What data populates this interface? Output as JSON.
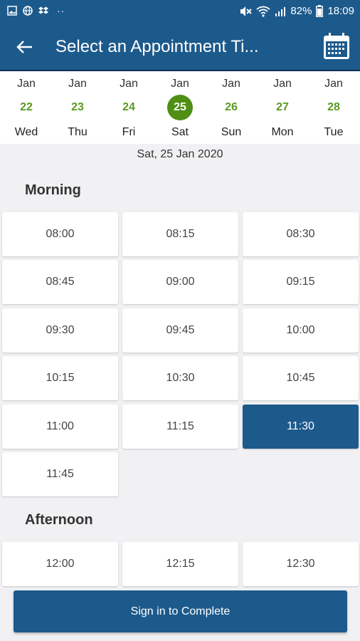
{
  "status_bar": {
    "battery": "82%",
    "time": "18:09",
    "dots": "··"
  },
  "app_bar": {
    "title": "Select an Appointment Ti..."
  },
  "days": [
    {
      "month": "Jan",
      "date": "22",
      "weekday": "Wed"
    },
    {
      "month": "Jan",
      "date": "23",
      "weekday": "Thu"
    },
    {
      "month": "Jan",
      "date": "24",
      "weekday": "Fri"
    },
    {
      "month": "Jan",
      "date": "25",
      "weekday": "Sat"
    },
    {
      "month": "Jan",
      "date": "26",
      "weekday": "Sun"
    },
    {
      "month": "Jan",
      "date": "27",
      "weekday": "Mon"
    },
    {
      "month": "Jan",
      "date": "28",
      "weekday": "Tue"
    }
  ],
  "selected_date_label": "Sat, 25 Jan 2020",
  "morning": {
    "title": "Morning",
    "slots": [
      "08:00",
      "08:15",
      "08:30",
      "08:45",
      "09:00",
      "09:15",
      "09:30",
      "09:45",
      "10:00",
      "10:15",
      "10:30",
      "10:45",
      "11:00",
      "11:15",
      "11:30",
      "11:45"
    ]
  },
  "afternoon": {
    "title": "Afternoon",
    "slots": [
      "12:00",
      "12:15",
      "12:30"
    ]
  },
  "selected_slot": "11:30",
  "cta_label": "Sign in to Complete",
  "colors": {
    "primary": "#1d5a8c",
    "accent_green": "#4e8f14"
  }
}
